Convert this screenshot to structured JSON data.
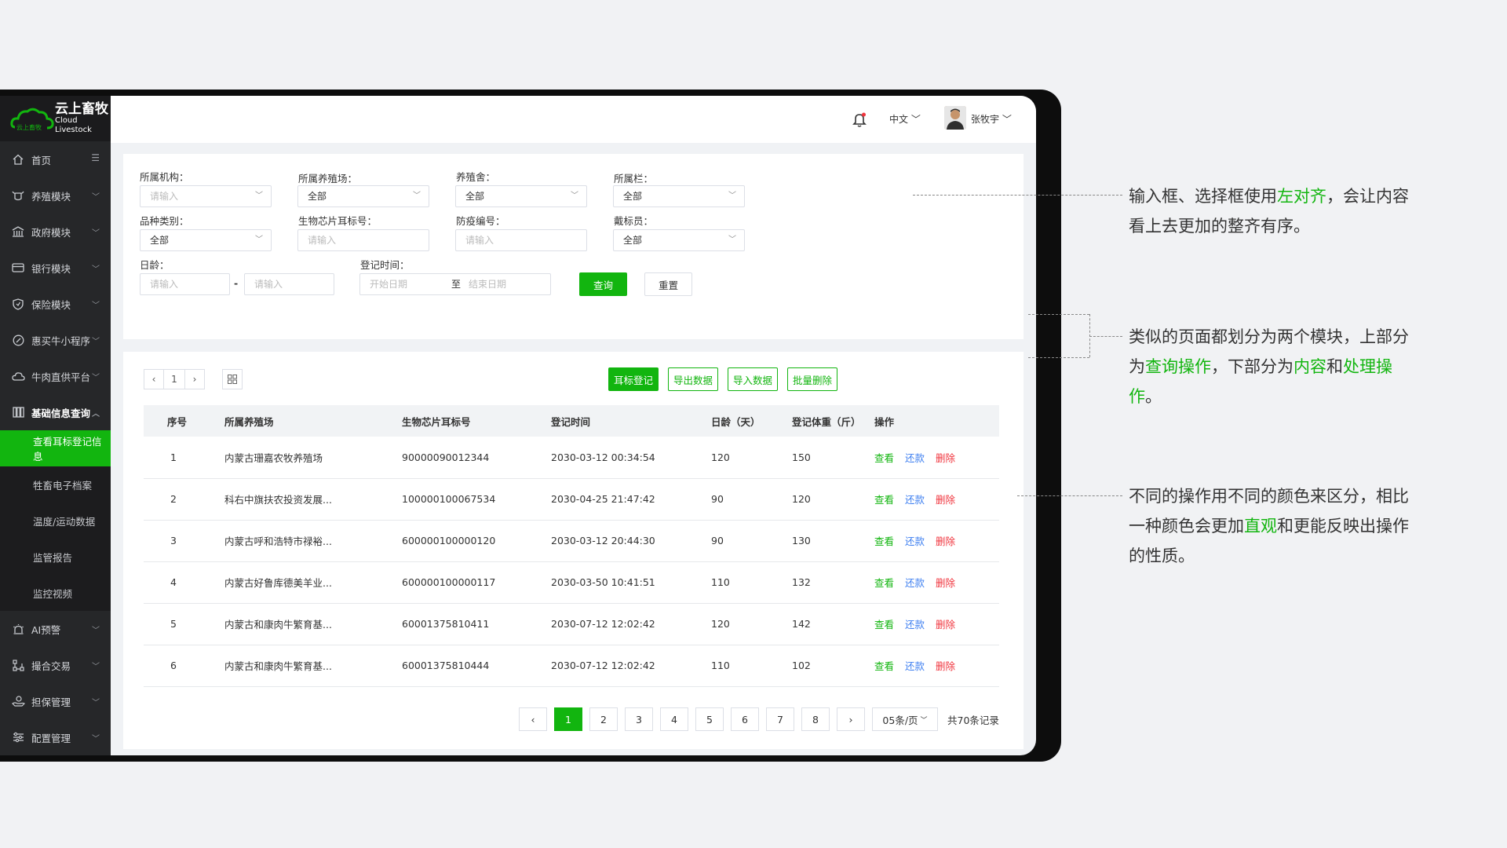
{
  "brand": {
    "title_cn": "云上畜牧",
    "title_en": "Cloud Livestock",
    "logo_text": "云上畜牧"
  },
  "colors": {
    "accent": "#12b50f",
    "repay": "#3c7ef0",
    "danger": "#f0333c",
    "sidebar": "#262729"
  },
  "sidebar": {
    "items": [
      {
        "label": "首页",
        "icon": "home-icon"
      },
      {
        "label": "养殖模块",
        "icon": "cow-icon"
      },
      {
        "label": "政府模块",
        "icon": "building-icon"
      },
      {
        "label": "银行模块",
        "icon": "card-icon"
      },
      {
        "label": "保险模块",
        "icon": "shield-icon"
      },
      {
        "label": "惠买牛小程序",
        "icon": "link-icon"
      },
      {
        "label": "牛肉直供平台",
        "icon": "cloud-icon"
      },
      {
        "label": "基础信息查询",
        "icon": "grid-icon"
      }
    ],
    "subitems": [
      {
        "label": "查看耳标登记信息",
        "active": true
      },
      {
        "label": "牲畜电子档案"
      },
      {
        "label": "温度/运动数据"
      },
      {
        "label": "监管报告"
      },
      {
        "label": "监控视频"
      }
    ],
    "bottom_items": [
      {
        "label": "AI预警",
        "icon": "alarm-icon"
      },
      {
        "label": "撮合交易",
        "icon": "network-icon"
      },
      {
        "label": "担保管理",
        "icon": "hand-icon"
      },
      {
        "label": "配置管理",
        "icon": "sliders-icon"
      }
    ]
  },
  "topbar": {
    "language": "中文",
    "username": "张牧宇"
  },
  "query": {
    "org_label": "所属机构：",
    "org_placeholder": "请输入",
    "farm_label": "所属养殖场：",
    "farm_value": "全部",
    "barn_label": "养殖舍：",
    "barn_value": "全部",
    "pen_label": "所属栏：",
    "pen_value": "全部",
    "breed_label": "品种类别：",
    "breed_value": "全部",
    "chip_label": "生物芯片耳标号：",
    "chip_placeholder": "请输入",
    "epidemic_label": "防疫编号：",
    "epidemic_placeholder": "请输入",
    "tagger_label": "戴标员：",
    "tagger_value": "全部",
    "age_label": "日龄：",
    "age_from_placeholder": "请输入",
    "age_sep": "-",
    "age_to_placeholder": "请输入",
    "time_label": "登记时间：",
    "start_placeholder": "开始日期",
    "to": "至",
    "end_placeholder": "结束日期",
    "search_btn": "查询",
    "reset_btn": "重置"
  },
  "content": {
    "mini_page": "1",
    "actions": [
      "耳标登记",
      "导出数据",
      "导入数据",
      "批量删除"
    ],
    "columns": [
      "序号",
      "所属养殖场",
      "生物芯片耳标号",
      "登记时间",
      "日龄（天）",
      "登记体重（斤）",
      "操作"
    ],
    "op_labels": {
      "view": "查看",
      "repay": "还款",
      "delete": "删除"
    },
    "rows": [
      {
        "no": "1",
        "farm": "内蒙古珊嘉农牧养殖场",
        "chip": "90000090012344",
        "time": "2030-03-12  00:34:54",
        "age": "120",
        "weight": "150"
      },
      {
        "no": "2",
        "farm": "科右中旗扶农投资发展...",
        "chip": "100000100067534",
        "time": "2030-04-25  21:47:42",
        "age": "90",
        "weight": "120"
      },
      {
        "no": "3",
        "farm": "内蒙古呼和浩特市禄裕...",
        "chip": "600000100000120",
        "time": "2030-03-12  20:44:30",
        "age": "90",
        "weight": "130"
      },
      {
        "no": "4",
        "farm": "内蒙古好鲁库德美羊业...",
        "chip": "600000100000117",
        "time": "2030-03-50  10:41:51",
        "age": "110",
        "weight": "132"
      },
      {
        "no": "5",
        "farm": "内蒙古和康肉牛繁育基...",
        "chip": "60001375810411",
        "time": "2030-07-12  12:02:42",
        "age": "120",
        "weight": "142"
      },
      {
        "no": "6",
        "farm": "内蒙古和康肉牛繁育基...",
        "chip": "60001375810444",
        "time": "2030-07-12  12:02:42",
        "age": "110",
        "weight": "102"
      }
    ],
    "pages": [
      "1",
      "2",
      "3",
      "4",
      "5",
      "6",
      "7",
      "8"
    ],
    "current_page": "1",
    "per_page": "05条/页",
    "total": "共70条记录"
  },
  "annotations": [
    {
      "parts": [
        {
          "t": "输入框、选择框使用"
        },
        {
          "t": "左对齐",
          "hl": true
        },
        {
          "t": "，会让内容看上去更加的整齐有序。"
        }
      ]
    },
    {
      "parts": [
        {
          "t": "类似的页面都划分为两个模块，上部分为"
        },
        {
          "t": "查询操作",
          "hl": true
        },
        {
          "t": "，下部分为"
        },
        {
          "t": "内容",
          "hl": true
        },
        {
          "t": "和"
        },
        {
          "t": "处理操作",
          "hl": true
        },
        {
          "t": "。"
        }
      ]
    },
    {
      "parts": [
        {
          "t": "不同的操作用不同的颜色来区分，相比一种颜色会更加"
        },
        {
          "t": "直观",
          "hl": true
        },
        {
          "t": "和更能反映出操作的性质。"
        }
      ]
    }
  ]
}
